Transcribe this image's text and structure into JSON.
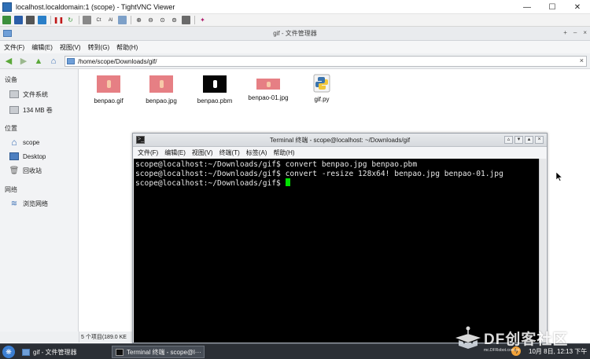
{
  "vnc": {
    "title": "localhost.localdomain:1 (scope) - TightVNC Viewer",
    "controls": {
      "minimize": "—",
      "maximize": "☐",
      "close": "✕"
    }
  },
  "file_manager": {
    "title": "gif - 文件管理器",
    "title_controls": [
      "+",
      "–",
      "×"
    ],
    "menu": [
      "文件(F)",
      "编辑(E)",
      "视图(V)",
      "转到(G)",
      "帮助(H)"
    ],
    "path": "/home/scope/Downloads/gif/",
    "sidebar": {
      "devices_header": "设备",
      "devices": [
        {
          "label": "文件系统",
          "icon": "drive-icon"
        },
        {
          "label": "134 MB 卷",
          "icon": "drive-icon"
        }
      ],
      "places_header": "位置",
      "places": [
        {
          "label": "scope",
          "icon": "home-icon"
        },
        {
          "label": "Desktop",
          "icon": "desktop-icon"
        },
        {
          "label": "回收站",
          "icon": "trash-icon"
        }
      ],
      "network_header": "网络",
      "network": [
        {
          "label": "浏览网络",
          "icon": "wifi-icon"
        }
      ]
    },
    "files": [
      {
        "name": "benpao.gif",
        "thumb": "pink"
      },
      {
        "name": "benpao.jpg",
        "thumb": "pink"
      },
      {
        "name": "benpao.pbm",
        "thumb": "black"
      },
      {
        "name": "benpao-01.jpg",
        "thumb": "pink"
      },
      {
        "name": "gif.py",
        "thumb": "python"
      }
    ],
    "status": "5 个项目(189.0 KE"
  },
  "terminal": {
    "title": "Terminal 终端 - scope@localhost: ~/Downloads/gif",
    "menu": [
      "文件(F)",
      "编辑(E)",
      "视图(V)",
      "终端(T)",
      "标签(A)",
      "帮助(H)"
    ],
    "lines": [
      "scope@localhost:~/Downloads/gif$ convert benpao.jpg benpao.pbm",
      "scope@localhost:~/Downloads/gif$ convert -resize 128x64! benpao.jpg benpao-01.jpg",
      "scope@localhost:~/Downloads/gif$ "
    ]
  },
  "taskbar": {
    "tasks": [
      {
        "label": "gif - 文件管理器",
        "active": false
      },
      {
        "label": "Terminal 终端 - scope@l···",
        "active": true
      }
    ],
    "clock": "10月 8日, 12:13 下午"
  },
  "watermark": {
    "text": "DF创客社区",
    "url": "mc.DFRobot.com.cn"
  },
  "colors": {
    "cursor": "#00e000",
    "terminal_bg": "#000000",
    "taskbar": "#2b2f35",
    "thumb_pink": "#e67f84"
  }
}
